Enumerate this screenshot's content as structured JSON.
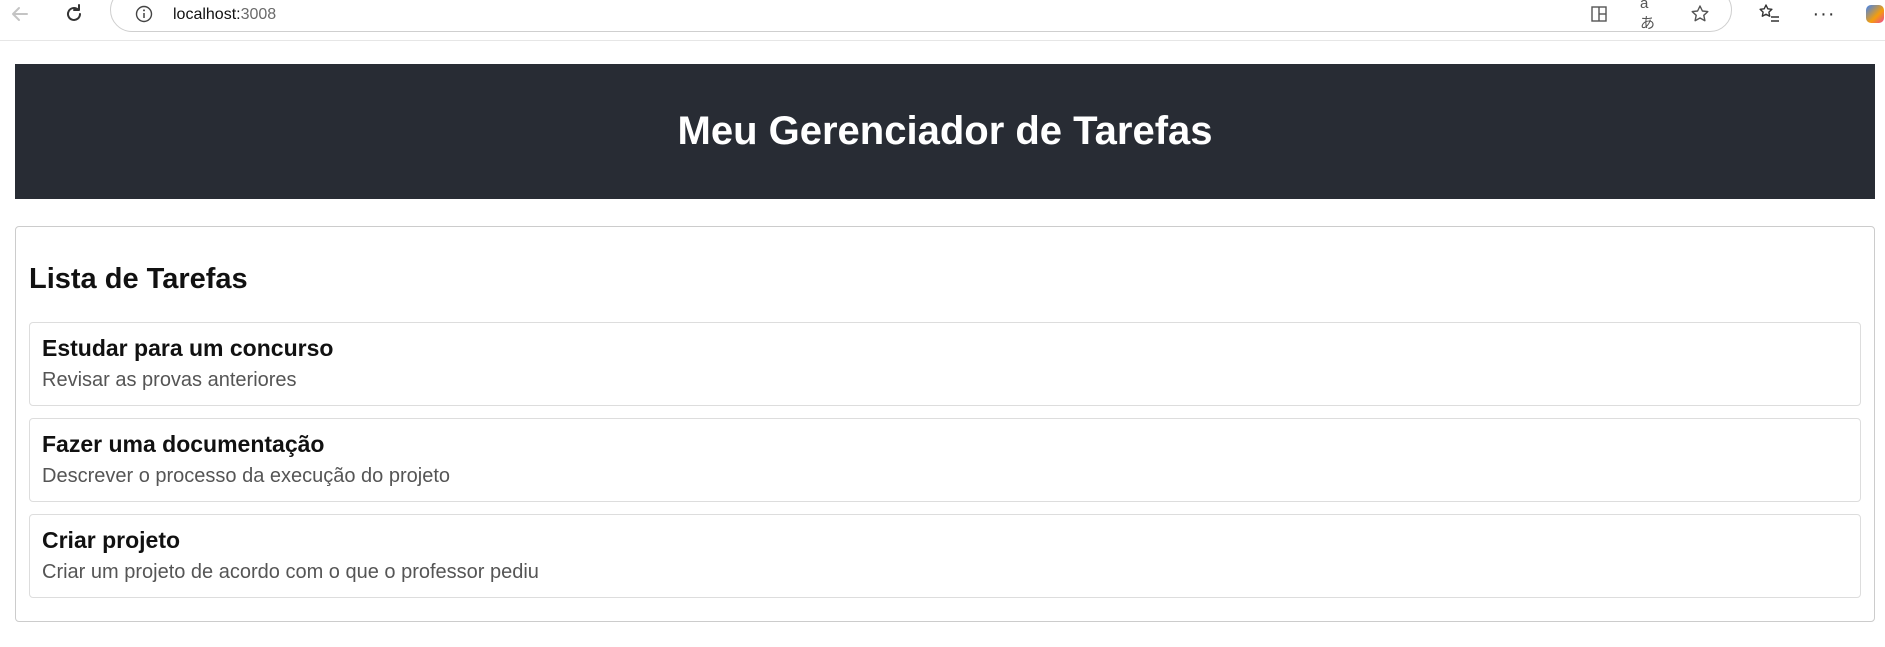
{
  "browser": {
    "url_host": "localhost:",
    "url_port": "3008",
    "icons": [
      "back-icon",
      "reload-icon",
      "info-icon",
      "split-screen-icon",
      "read-aloud-icon",
      "favorite-star-icon",
      "favorites-list-icon",
      "more-icon",
      "copilot-icon"
    ]
  },
  "header": {
    "title": "Meu Gerenciador de Tarefas",
    "background": "#282c34"
  },
  "task_list": {
    "heading": "Lista de Tarefas",
    "tasks": [
      {
        "title": "Estudar para um concurso",
        "description": "Revisar as provas anteriores"
      },
      {
        "title": "Fazer uma documentação",
        "description": "Descrever o processo da execução do projeto"
      },
      {
        "title": "Criar projeto",
        "description": "Criar um projeto de acordo com o que o professor pediu"
      }
    ]
  }
}
